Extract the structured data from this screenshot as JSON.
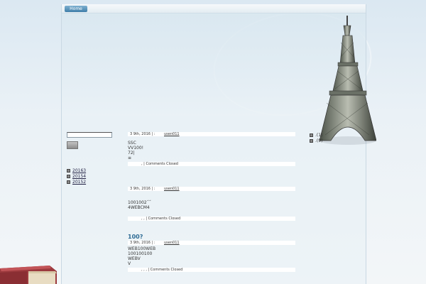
{
  "nav": {
    "home_label": "Home"
  },
  "search": {
    "button_label": ""
  },
  "archives": [
    "20163",
    "20154",
    "20152"
  ],
  "right_sidebar": [
    ".(1)",
    ".(9)"
  ],
  "posts": [
    {
      "title": "",
      "date": "3 9th, 2016 | :",
      "author": "usen011",
      "body": [
        "SSC",
        "VV100!",
        "72|",
        "≡"
      ],
      "footer": ", | Comments Closed"
    },
    {
      "title": "",
      "date": "3 9th, 2016 | :",
      "author": "usen011",
      "body": [
        "",
        "1001002˝˝",
        "4WEBCM4"
      ],
      "footer": ", , | Comments Closed"
    },
    {
      "title": "100?",
      "date": "3 9th, 2016 | :",
      "author": "usen011",
      "body": [
        "WEB100WEB",
        "100100100",
        "WEBV",
        "V"
      ],
      "footer": ", , , | Comments Closed"
    }
  ],
  "colors": {
    "accent": "#2d6b94",
    "nav_button": "#4f8db5",
    "page_bg": "#e8f0f5"
  }
}
